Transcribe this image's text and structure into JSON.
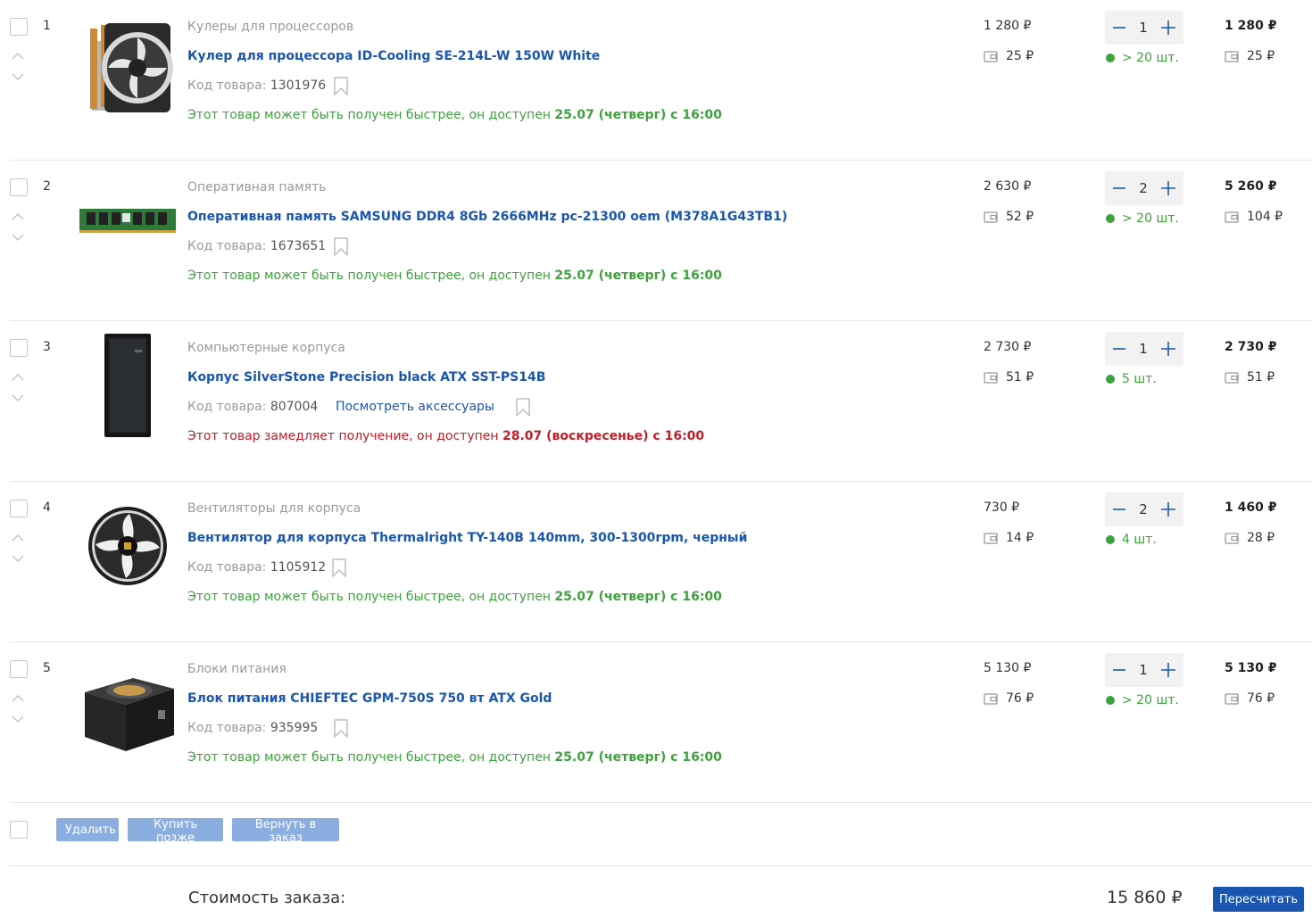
{
  "items": [
    {
      "index": "1",
      "category": "Кулеры для процессоров",
      "title": "Кулер для процессора ID-Cooling SE-214L-W 150W White",
      "code_label": "Код товара:",
      "code": "1301976",
      "availability_prefix": "Этот товар может быть получен быстрее, он доступен ",
      "availability_date": "25.07 (четверг) с 16:00",
      "price": "1 280 ₽",
      "bonus": "25 ₽",
      "quantity": "1",
      "stock": "> 20 шт.",
      "total": "1 280 ₽",
      "total_bonus": "25 ₽",
      "image_icon": "cpu-cooler-icon"
    },
    {
      "index": "2",
      "category": "Оперативная память",
      "title": "Оперативная память SAMSUNG DDR4 8Gb 2666MHz pc-21300 oem (M378A1G43TB1)",
      "code_label": "Код товара:",
      "code": "1673651",
      "availability_prefix": "Этот товар может быть получен быстрее, он доступен ",
      "availability_date": "25.07 (четверг) с 16:00",
      "price": "2 630 ₽",
      "bonus": "52 ₽",
      "quantity": "2",
      "stock": "> 20 шт.",
      "total": "5 260 ₽",
      "total_bonus": "104 ₽",
      "image_icon": "ram-module-icon"
    },
    {
      "index": "3",
      "category": "Компьютерные корпуса",
      "title": "Корпус SilverStone Precision black ATX SST-PS14B",
      "code_label": "Код товара:",
      "code": "807004",
      "accessories_link": "Посмотреть аксессуары",
      "availability_prefix": "Этот товар замедляет получение, он доступен ",
      "availability_date": "28.07 (воскресенье) с 16:00",
      "price": "2 730 ₽",
      "bonus": "51 ₽",
      "quantity": "1",
      "stock": "5 шт.",
      "total": "2 730 ₽",
      "total_bonus": "51 ₽",
      "image_icon": "pc-case-icon"
    },
    {
      "index": "4",
      "category": "Вентиляторы для корпуса",
      "title": "Вентилятор для корпуса Thermalright TY-140B 140mm, 300-1300rpm, черный",
      "code_label": "Код товара:",
      "code": "1105912",
      "availability_prefix": "Этот товар может быть получен быстрее, он доступен ",
      "availability_date": "25.07 (четверг) с 16:00",
      "price": "730 ₽",
      "bonus": "14 ₽",
      "quantity": "2",
      "stock": "4 шт.",
      "total": "1 460 ₽",
      "total_bonus": "28 ₽",
      "image_icon": "case-fan-icon"
    },
    {
      "index": "5",
      "category": "Блоки питания",
      "title": "Блок питания CHIEFTEC GPM-750S 750 вт ATX Gold",
      "code_label": "Код товара:",
      "code": "935995",
      "availability_prefix": "Этот товар может быть получен быстрее, он доступен ",
      "availability_date": "25.07 (четверг) с 16:00",
      "price": "5 130 ₽",
      "bonus": "76 ₽",
      "quantity": "1",
      "stock": "> 20 шт.",
      "total": "5 130 ₽",
      "total_bonus": "76 ₽",
      "image_icon": "power-supply-icon"
    }
  ],
  "actions": {
    "delete_label": "Удалить",
    "buy_later_label": "Купить позже",
    "return_label": "Вернуть в заказ"
  },
  "summary": {
    "label": "Стоимость заказа:",
    "value": "15 860 ₽",
    "recalc_label": "Пересчитать"
  },
  "colors": {
    "link": "#1a56b0",
    "fast": "#3da23d",
    "slow": "#c0202a",
    "action_button": "#8aaee0",
    "primary_button": "#1a56b0"
  }
}
